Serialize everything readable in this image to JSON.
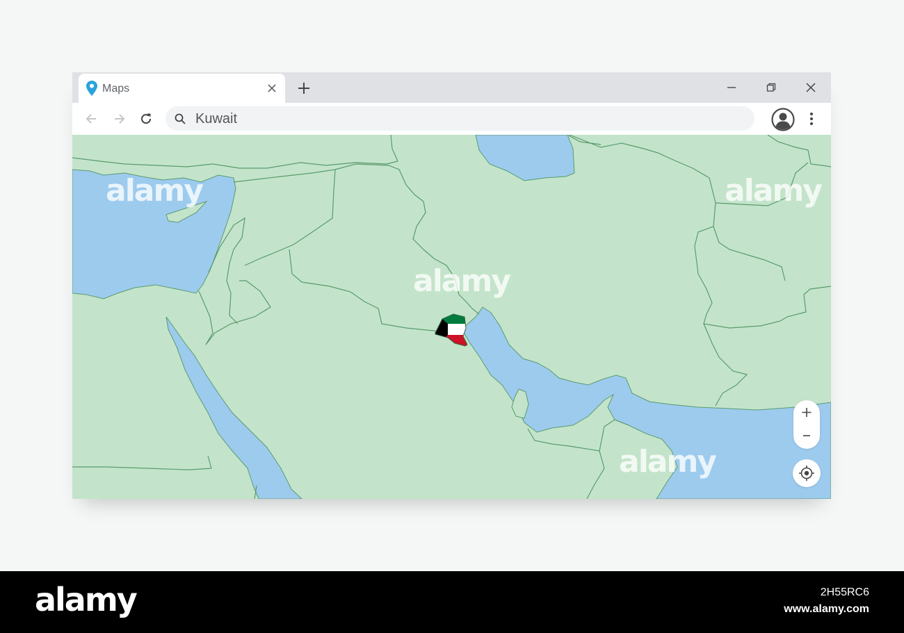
{
  "browser": {
    "tab": {
      "title": "Maps",
      "icon": "map-pin-icon",
      "close_icon": "close-icon"
    },
    "new_tab_icon": "plus-icon",
    "window_controls": [
      "minimize-icon",
      "restore-icon",
      "close-icon"
    ],
    "toolbar": {
      "back_icon": "arrow-left-icon",
      "forward_icon": "arrow-right-icon",
      "reload_icon": "reload-icon",
      "search_icon": "search-icon",
      "search_value": "Kuwait",
      "profile_icon": "user-avatar-icon",
      "menu_icon": "more-vert-icon"
    }
  },
  "map": {
    "highlighted_country": "Kuwait",
    "flag_colors": [
      "#007a3d",
      "#ffffff",
      "#ce1126",
      "#000000"
    ],
    "land_color": "#c3e4ca",
    "water_color": "#9dcbee",
    "border_color": "#5a9a6e",
    "controls": {
      "zoom_in": "+",
      "zoom_out": "−",
      "locate_icon": "crosshair-icon"
    }
  },
  "watermark": {
    "overlay_text": "alamy",
    "brand": "alamy",
    "image_id": "2H55RC6",
    "site": "www.alamy.com"
  }
}
